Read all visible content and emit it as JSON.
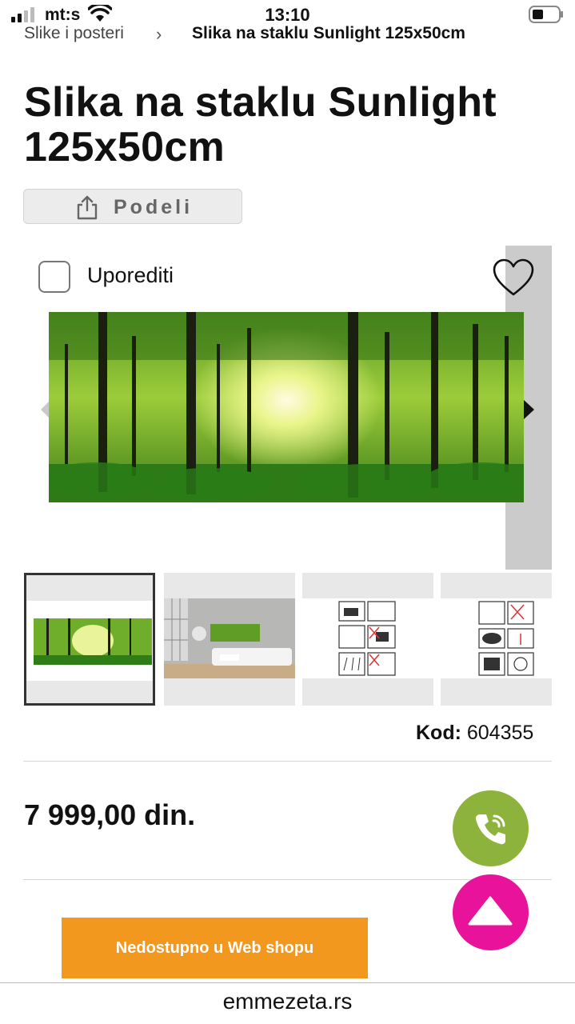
{
  "status_bar": {
    "carrier": "mt:s",
    "time": "13:10"
  },
  "breadcrumb": {
    "parent": "Slike i posteri",
    "separator": "›",
    "current": "Slika na staklu Sunlight 125x50cm"
  },
  "product": {
    "title": "Slika na staklu Sunlight 125x50cm",
    "share_label": "Podeli",
    "compare_label": "Uporediti",
    "code_label": "Kod:",
    "code_value": "604355",
    "price": "7 999,00 din.",
    "buy_label": "Nedostupno u Web shopu"
  },
  "gallery": {
    "thumbnails": [
      "forest-panorama",
      "living-room-scene",
      "mounting-instructions-1",
      "mounting-instructions-2"
    ],
    "selected_index": 0
  },
  "colors": {
    "accent_orange": "#f3981f",
    "call_green": "#8db33c",
    "top_pink": "#e8139a"
  },
  "footer": {
    "domain": "emmezeta.rs"
  }
}
